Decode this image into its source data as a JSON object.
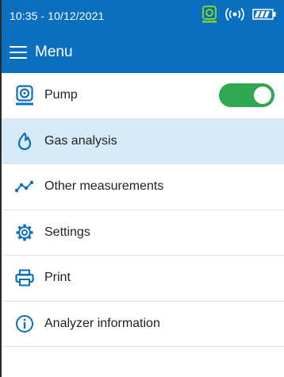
{
  "status_bar": {
    "clock": "10:35 - 10/12/2021",
    "icons": [
      "pump-status-icon",
      "wireless-icon",
      "battery-icon"
    ],
    "pump_icon_color": "#7ed321"
  },
  "header": {
    "title": "Menu",
    "color": "#0b6fc0"
  },
  "menu": {
    "items": [
      {
        "label": "Pump",
        "icon": "pump-icon",
        "toggle_on": true
      },
      {
        "label": "Gas analysis",
        "icon": "flame-icon",
        "active": true
      },
      {
        "label": "Other measurements",
        "icon": "graph-line-icon"
      },
      {
        "label": "Settings",
        "icon": "gear-icon"
      },
      {
        "label": "Print",
        "icon": "printer-icon"
      },
      {
        "label": "Analyzer information",
        "icon": "info-icon"
      }
    ],
    "accent_color": "#0b6fc0",
    "active_background": "#d6eaf8",
    "toggle_color": "#2fa84f"
  }
}
